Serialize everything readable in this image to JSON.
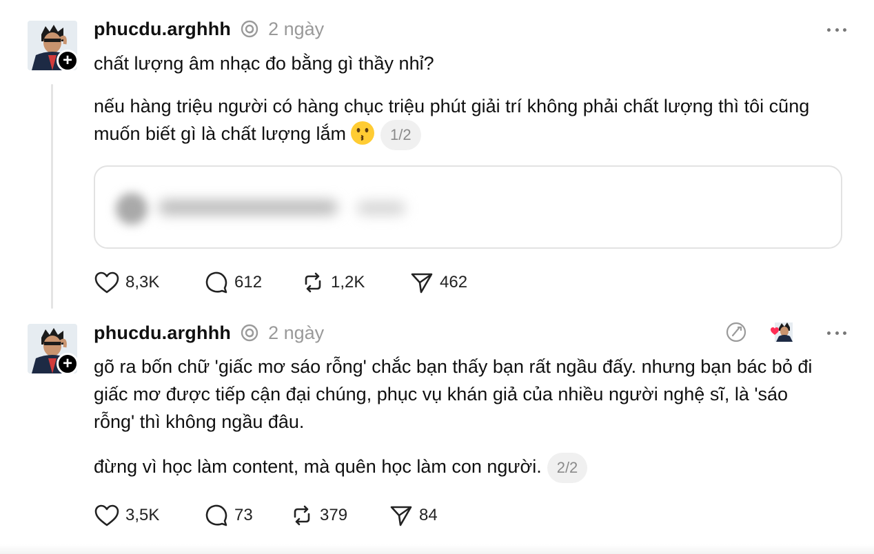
{
  "posts": [
    {
      "username": "phucdu.arghhh",
      "timestamp": "2 ngày",
      "paragraphs": [
        "chất lượng âm nhạc đo bằng gì thầy nhỉ?",
        "nếu hàng triệu người có hàng chục triệu phút giải trí không phải chất lượng thì tôi cũng muốn biết gì là chất lượng lắm"
      ],
      "page_indicator": "1/2",
      "stats": {
        "likes": "8,3K",
        "replies": "612",
        "reposts": "1,2K",
        "shares": "462"
      }
    },
    {
      "username": "phucdu.arghhh",
      "timestamp": "2 ngày",
      "paragraphs": [
        "gõ ra bốn chữ 'giấc mơ sáo rỗng' chắc bạn thấy bạn rất ngầu đấy. nhưng bạn bác bỏ đi giấc mơ được tiếp cận đại chúng, phục vụ khán giả của nhiều người nghệ sĩ, là 'sáo rỗng' thì không ngầu đâu.",
        "đừng vì học làm content, mà quên học làm con người."
      ],
      "page_indicator": "2/2",
      "stats": {
        "likes": "3,5K",
        "replies": "73",
        "reposts": "379",
        "shares": "84"
      }
    }
  ],
  "icons": {
    "follow": "plus-icon",
    "verified": "threads-badge-icon",
    "more": "more-horizontal-icon",
    "like": "heart-icon",
    "reply": "comment-icon",
    "repost": "repost-icon",
    "share": "send-icon",
    "emoji": "kissing-face-emoji",
    "edited": "edit-circle-icon",
    "liked_by_author": "heart-avatar-icon"
  },
  "colors": {
    "text": "#101010",
    "muted": "#999999",
    "accent_like": "#ff2d55",
    "pill_bg": "#f0f0f0"
  }
}
